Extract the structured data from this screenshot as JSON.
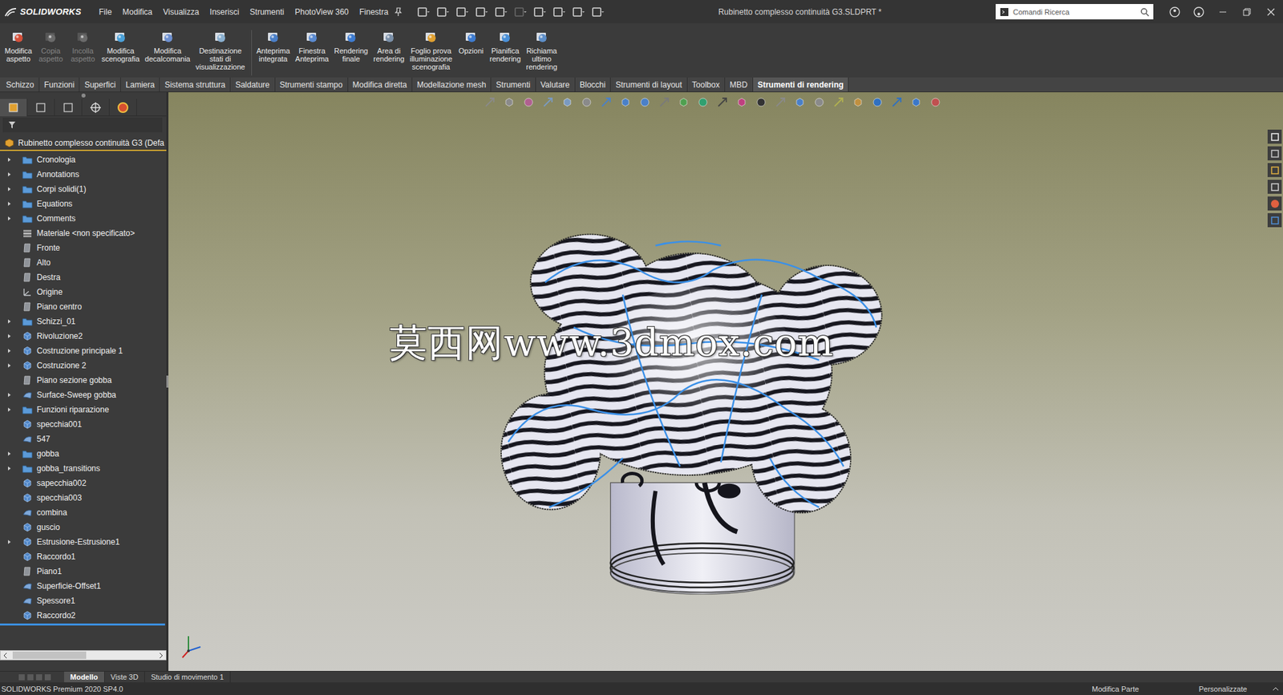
{
  "window": {
    "title": "Rubinetto complesso continuità G3.SLDPRT *",
    "logo": "SOLIDWORKS"
  },
  "menu": [
    "File",
    "Modifica",
    "Visualizza",
    "Inserisci",
    "Strumenti",
    "PhotoView 360",
    "Finestra"
  ],
  "search": {
    "placeholder": "Comandi Ricerca"
  },
  "ribbon": {
    "groups": [
      [
        {
          "lines": [
            "Modifica",
            "aspetto"
          ],
          "disabled": false
        },
        {
          "lines": [
            "Copia",
            "aspetto"
          ],
          "disabled": true
        },
        {
          "lines": [
            "Incolla",
            "aspetto"
          ],
          "disabled": true
        },
        {
          "lines": [
            "Modifica",
            "scenografia"
          ],
          "disabled": false
        },
        {
          "lines": [
            "Modifica",
            "decalcomania"
          ],
          "disabled": false
        },
        {
          "lines": [
            "Destinazione",
            "stati di",
            "visualizzazione"
          ],
          "disabled": false
        }
      ],
      [
        {
          "lines": [
            "Anteprima",
            "integrata"
          ],
          "disabled": false
        },
        {
          "lines": [
            "Finestra",
            "Anteprima"
          ],
          "disabled": false
        },
        {
          "lines": [
            "Rendering",
            "finale"
          ],
          "disabled": false
        },
        {
          "lines": [
            "Area di",
            "rendering"
          ],
          "disabled": false
        },
        {
          "lines": [
            "Foglio prova",
            "illuminazione",
            "scenografia"
          ],
          "disabled": false
        },
        {
          "lines": [
            "Opzioni"
          ],
          "disabled": false
        },
        {
          "lines": [
            "Pianifica",
            "rendering"
          ],
          "disabled": false
        },
        {
          "lines": [
            "Richiama",
            "ultimo",
            "rendering"
          ],
          "disabled": false
        }
      ]
    ]
  },
  "tabs": [
    {
      "label": "Schizzo",
      "selected": false
    },
    {
      "label": "Funzioni",
      "selected": false
    },
    {
      "label": "Superfici",
      "selected": false
    },
    {
      "label": "Lamiera",
      "selected": false
    },
    {
      "label": "Sistema struttura",
      "selected": false
    },
    {
      "label": "Saldature",
      "selected": false
    },
    {
      "label": "Strumenti stampo",
      "selected": false
    },
    {
      "label": "Modifica diretta",
      "selected": false
    },
    {
      "label": "Modellazione mesh",
      "selected": false
    },
    {
      "label": "Strumenti",
      "selected": false
    },
    {
      "label": "Valutare",
      "selected": false
    },
    {
      "label": "Blocchi",
      "selected": false
    },
    {
      "label": "Strumenti di layout",
      "selected": false
    },
    {
      "label": "Toolbox",
      "selected": false
    },
    {
      "label": "MBD",
      "selected": false
    },
    {
      "label": "Strumenti di rendering",
      "selected": true
    }
  ],
  "tree": {
    "root": "Rubinetto complesso continuità G3  (Defa",
    "items": [
      {
        "label": "Cronologia",
        "expandable": true,
        "kind": "folder"
      },
      {
        "label": "Annotations",
        "expandable": true,
        "kind": "folder"
      },
      {
        "label": "Corpi solidi(1)",
        "expandable": true,
        "kind": "folder"
      },
      {
        "label": "Equations",
        "expandable": true,
        "kind": "folder"
      },
      {
        "label": "Comments",
        "expandable": true,
        "kind": "folder"
      },
      {
        "label": "Materiale <non specificato>",
        "expandable": false,
        "kind": "material"
      },
      {
        "label": "Fronte",
        "expandable": false,
        "kind": "plane"
      },
      {
        "label": "Alto",
        "expandable": false,
        "kind": "plane"
      },
      {
        "label": "Destra",
        "expandable": false,
        "kind": "plane"
      },
      {
        "label": "Origine",
        "expandable": false,
        "kind": "origin"
      },
      {
        "label": "Piano centro",
        "expandable": false,
        "kind": "plane"
      },
      {
        "label": "Schizzi_01",
        "expandable": true,
        "kind": "folder"
      },
      {
        "label": "Rivoluzione2",
        "expandable": true,
        "kind": "feature"
      },
      {
        "label": "Costruzione principale 1",
        "expandable": true,
        "kind": "feature"
      },
      {
        "label": "Costruzione 2",
        "expandable": true,
        "kind": "feature"
      },
      {
        "label": "Piano sezione gobba",
        "expandable": false,
        "kind": "plane"
      },
      {
        "label": "Surface-Sweep gobba",
        "expandable": true,
        "kind": "surface"
      },
      {
        "label": "Funzioni riparazione",
        "expandable": true,
        "kind": "folder"
      },
      {
        "label": "specchia001",
        "expandable": false,
        "kind": "feature"
      },
      {
        "label": "547",
        "expandable": false,
        "kind": "surface"
      },
      {
        "label": "gobba",
        "expandable": true,
        "kind": "folder"
      },
      {
        "label": "gobba_transitions",
        "expandable": true,
        "kind": "folder"
      },
      {
        "label": "sapecchia002",
        "expandable": false,
        "kind": "feature"
      },
      {
        "label": "specchia003",
        "expandable": false,
        "kind": "feature"
      },
      {
        "label": "combina",
        "expandable": false,
        "kind": "surface"
      },
      {
        "label": "guscio",
        "expandable": false,
        "kind": "feature"
      },
      {
        "label": "Estrusione-Estrusione1",
        "expandable": true,
        "kind": "feature"
      },
      {
        "label": "Raccordo1",
        "expandable": false,
        "kind": "feature"
      },
      {
        "label": "Piano1",
        "expandable": false,
        "kind": "plane"
      },
      {
        "label": "Superficie-Offset1",
        "expandable": false,
        "kind": "surface"
      },
      {
        "label": "Spessore1",
        "expandable": false,
        "kind": "surface"
      },
      {
        "label": "Raccordo2",
        "expandable": false,
        "kind": "feature"
      }
    ]
  },
  "viewport": {
    "watermark": "莫西网www.3dmox.com"
  },
  "bottom_tabs": [
    {
      "label": "Modello",
      "selected": true
    },
    {
      "label": "Viste 3D",
      "selected": false
    },
    {
      "label": "Studio di movimento 1",
      "selected": false
    }
  ],
  "status_bar": {
    "version": "SOLIDWORKS Premium 2020 SP4.0",
    "mode": "Modifica Parte",
    "units": "Personalizzate"
  }
}
